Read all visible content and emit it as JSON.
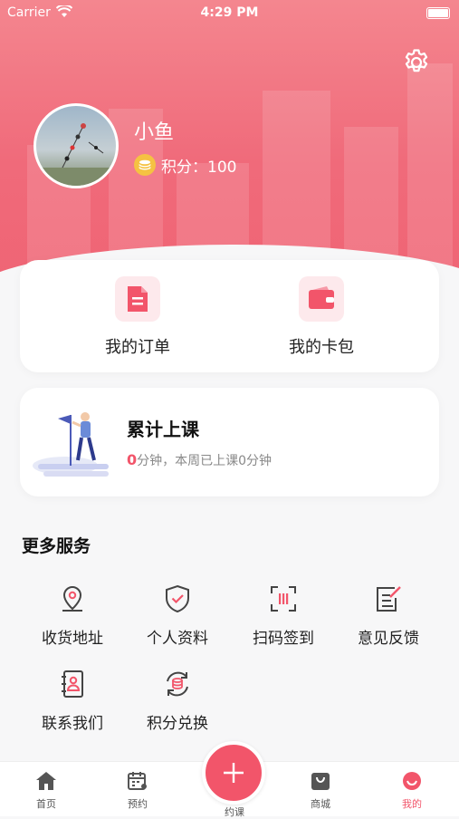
{
  "status_bar": {
    "carrier": "Carrier",
    "time": "4:29 PM"
  },
  "profile": {
    "name": "小鱼",
    "points_text": "积分：100"
  },
  "quick_actions": [
    {
      "label": "我的订单",
      "icon": "document-icon"
    },
    {
      "label": "我的卡包",
      "icon": "wallet-icon"
    }
  ],
  "study": {
    "title": "累计上课",
    "minutes": "0",
    "subtitle": "分钟，本周已上课0分钟"
  },
  "services": {
    "title": "更多服务",
    "items": [
      {
        "label": "收货地址",
        "icon": "location-pin-icon"
      },
      {
        "label": "个人资料",
        "icon": "shield-check-icon"
      },
      {
        "label": "扫码签到",
        "icon": "scan-icon"
      },
      {
        "label": "意见反馈",
        "icon": "edit-note-icon"
      },
      {
        "label": "联系我们",
        "icon": "contact-book-icon"
      },
      {
        "label": "积分兑换",
        "icon": "points-exchange-icon"
      }
    ]
  },
  "tabbar": {
    "home": "首页",
    "booking": "预约",
    "book_class": "约课",
    "shop": "商城",
    "mine": "我的"
  },
  "colors": {
    "accent": "#f2556a",
    "hero": "#f06a7a",
    "coin": "#f5c242"
  }
}
